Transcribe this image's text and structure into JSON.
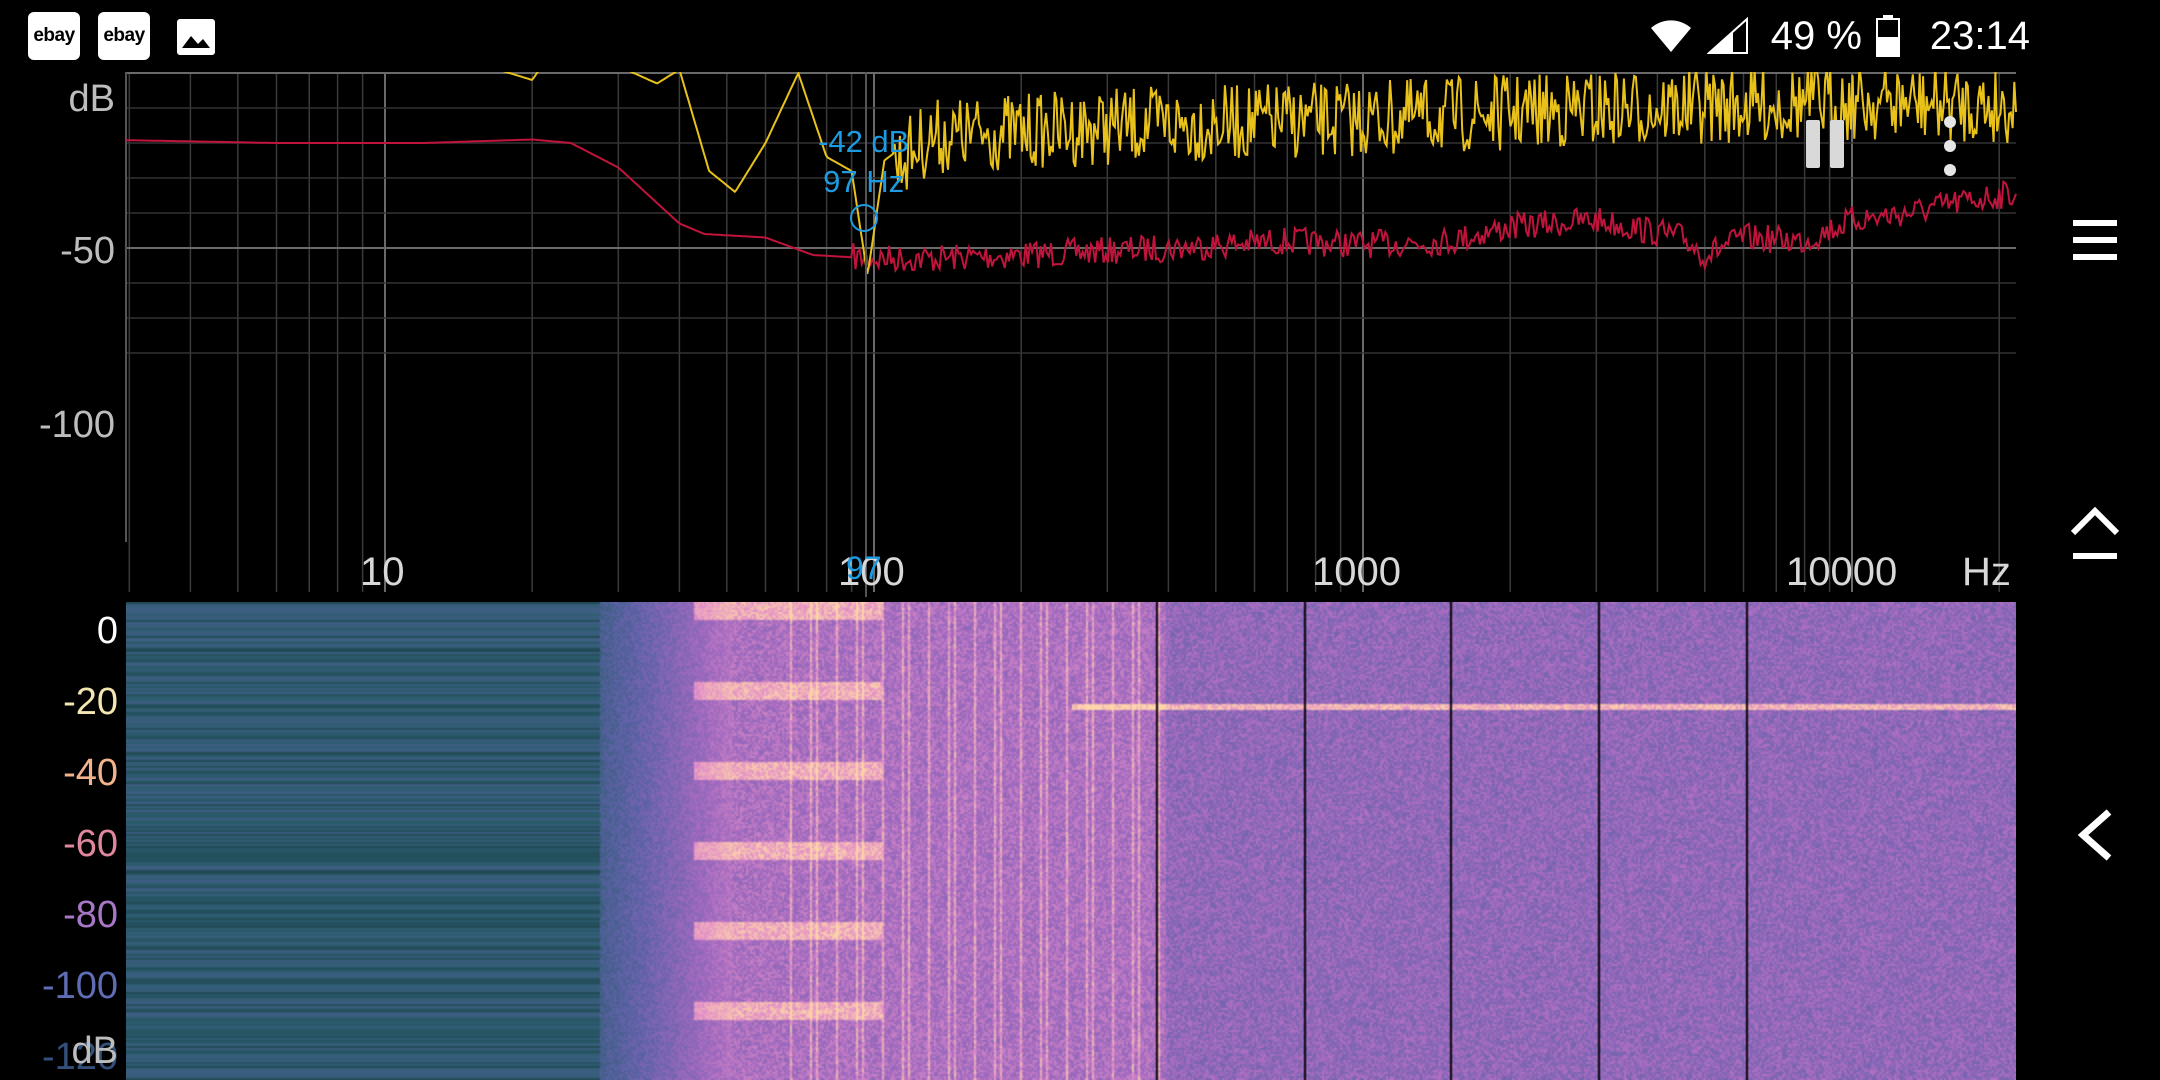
{
  "status_bar": {
    "notifications": [
      {
        "label": "ebay",
        "icon": "ebay-app-icon"
      },
      {
        "label": "ebay",
        "icon": "ebay-app-icon"
      },
      {
        "icon": "image-icon"
      }
    ],
    "wifi_icon": "wifi-icon",
    "signal_icon": "cell-signal-icon",
    "battery_percent": "49 %",
    "battery_icon": "battery-icon",
    "time": "23:14"
  },
  "spectrum": {
    "y_unit": "dB",
    "y_ticks": [
      "-50",
      "-100"
    ],
    "x_ticks": [
      "10",
      "100",
      "1000",
      "10000"
    ],
    "x_unit": "Hz",
    "peak": {
      "level": "-42 dB",
      "frequency": "97 Hz",
      "cursor_frequency": "97"
    },
    "colors": {
      "peak_hold_trace": "#c0143c",
      "live_trace": "#e8c21a",
      "cursor": "#1e9be0",
      "grid": "#4a4a4a"
    },
    "pause_icon": "pause-icon",
    "overflow_icon": "more-vert-icon"
  },
  "spectrogram": {
    "y_ticks": [
      "0",
      "-20",
      "-40",
      "-60",
      "-80",
      "-100",
      "-120"
    ],
    "y_tick_colors": [
      "#ffffff",
      "#f3e6b0",
      "#f2b38c",
      "#e0879e",
      "#a877c8",
      "#5f6db4",
      "#33507a"
    ],
    "y_unit": "dB",
    "palette": [
      "#0d2a2a",
      "#2c5c6e",
      "#5f62a8",
      "#a36ac0",
      "#e390c8",
      "#ffd7a8"
    ]
  },
  "nav": {
    "menu_icon": "hamburger-menu-icon",
    "home_icon": "chevron-up-home-icon",
    "back_icon": "back-chevron-icon"
  }
}
